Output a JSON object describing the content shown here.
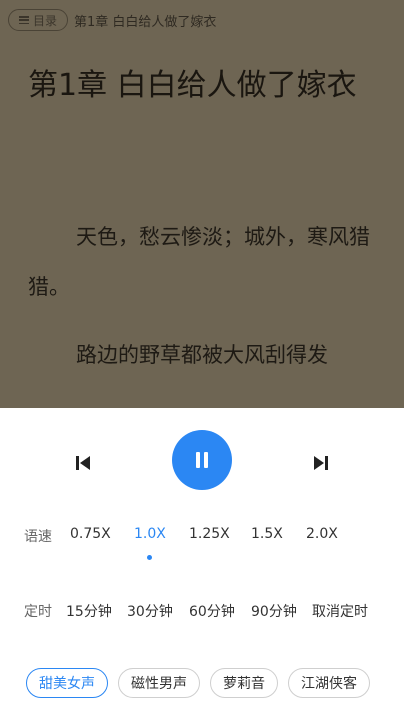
{
  "reader": {
    "catalog_label": "目录",
    "top_title": "第1章 白白给人做了嫁衣",
    "chapter_title": "第1章 白白给人做了嫁衣",
    "paragraphs": [
      "天色，愁云惨淡；城外，寒风猎猎。",
      "路边的野草都被大风刮得发"
    ]
  },
  "player": {
    "prev_icon": "skip-previous-icon",
    "play_icon": "pause-icon",
    "next_icon": "skip-next-icon",
    "accent_color": "#2b87f3"
  },
  "speed": {
    "label": "语速",
    "options": [
      "0.75X",
      "1.0X",
      "1.25X",
      "1.5X",
      "2.0X"
    ],
    "selected": "1.0X"
  },
  "timer": {
    "label": "定时",
    "options": [
      "15分钟",
      "30分钟",
      "60分钟",
      "90分钟",
      "取消定时"
    ]
  },
  "voices": {
    "options": [
      "甜美女声",
      "磁性男声",
      "萝莉音",
      "江湖侠客"
    ],
    "selected": "甜美女声"
  }
}
